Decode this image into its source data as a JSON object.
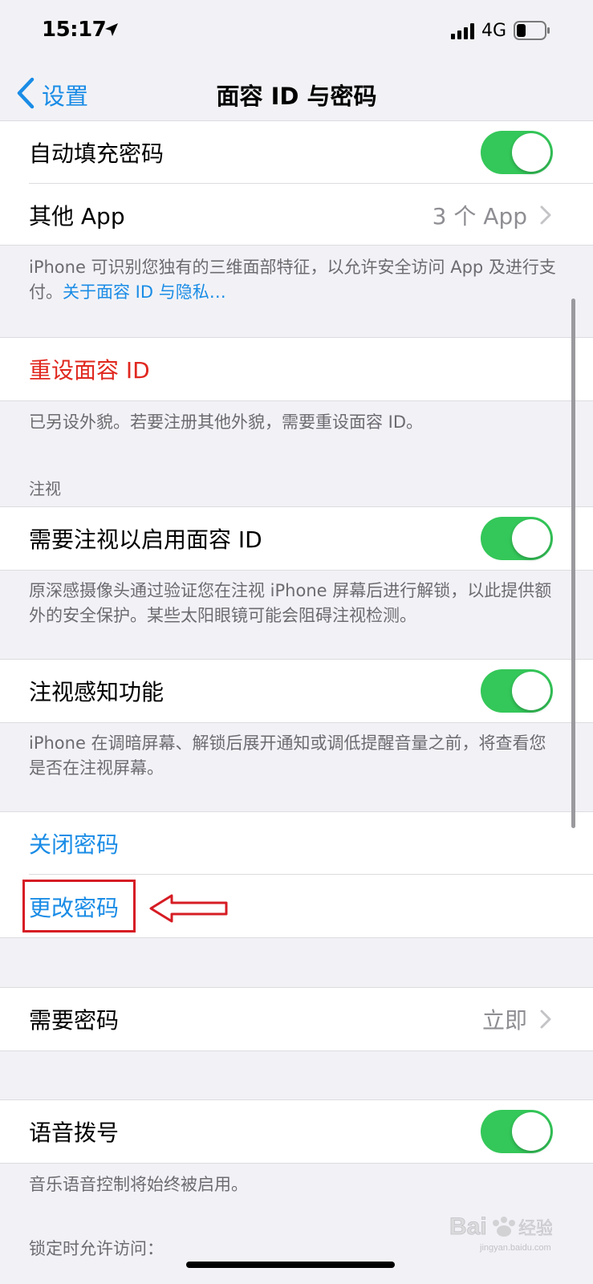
{
  "status_bar": {
    "time": "15:17",
    "network": "4G"
  },
  "nav": {
    "back_label": "设置",
    "title": "面容 ID 与密码"
  },
  "group1": {
    "autofill_label": "自动填充密码",
    "autofill_on": true,
    "other_apps_label": "其他 App",
    "other_apps_value": "3 个 App"
  },
  "footer1": {
    "text": "iPhone 可识别您独有的三维面部特征，以允许安全访问 App 及进行支付。",
    "link": "关于面容 ID 与隐私…"
  },
  "reset": {
    "label": "重设面容 ID"
  },
  "footer2": {
    "text": "已另设外貌。若要注册其他外貌，需要重设面容 ID。"
  },
  "attention_header": "注视",
  "require_attention": {
    "label": "需要注视以启用面容 ID",
    "on": true
  },
  "footer3": {
    "text": "原深感摄像头通过验证您在注视 iPhone 屏幕后进行解锁，以此提供额外的安全保护。某些太阳眼镜可能会阻碍注视检测。"
  },
  "attention_aware": {
    "label": "注视感知功能",
    "on": true
  },
  "footer4": {
    "text": "iPhone 在调暗屏幕、解锁后展开通知或调低提醒音量之前，将查看您是否在注视屏幕。"
  },
  "passcode": {
    "turn_off_label": "关闭密码",
    "change_label": "更改密码"
  },
  "require_passcode": {
    "label": "需要密码",
    "value": "立即"
  },
  "voice_dial": {
    "label": "语音拨号",
    "on": true
  },
  "footer5": {
    "text": "音乐语音控制将始终被启用。"
  },
  "locked_header": "锁定时允许访问：",
  "watermark": {
    "brand": "Baidu 经验",
    "url": "jingyan.baidu.com"
  },
  "colors": {
    "accent_blue": "#1a8ce6",
    "toggle_green": "#34c759",
    "destructive_red": "#e0281f",
    "annotation_red": "#d61c24"
  }
}
